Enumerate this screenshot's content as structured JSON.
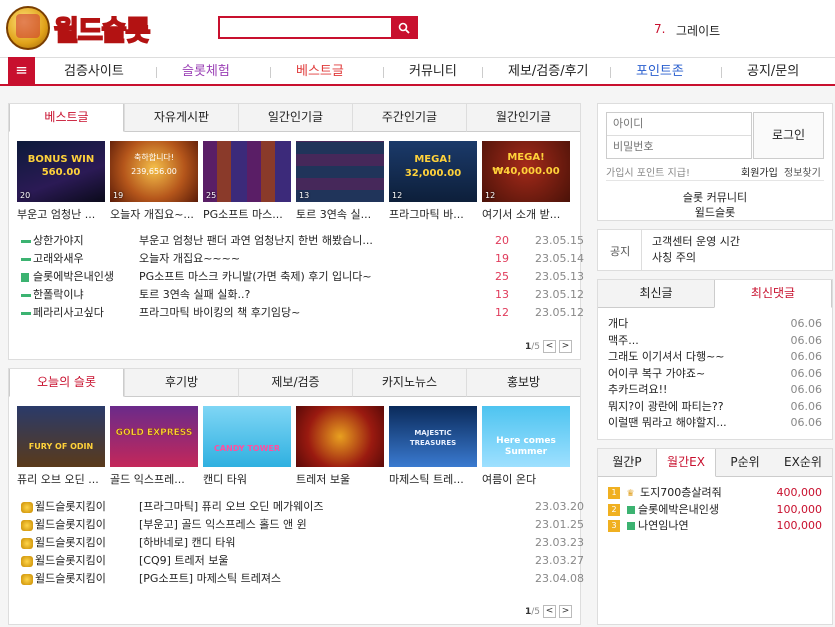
{
  "header": {
    "logo_text": "윌드슬롯",
    "search_placeholder": "",
    "rank_number": "7.",
    "rank_text": "그레이트"
  },
  "nav": {
    "menu_icon": "hamburger-icon",
    "items": [
      "검증사이트",
      "슬롯체험",
      "베스트글",
      "커뮤니티",
      "제보/검증/후기",
      "포인트존",
      "공지/문의"
    ],
    "colors": {
      "슬롯체험": "#9a3fb5",
      "베스트글": "#e03b3b",
      "포인트존": "#2a5fcf"
    }
  },
  "best": {
    "tabs": [
      "베스트글",
      "자유게시판",
      "일간인기글",
      "주간인기글",
      "월간인기글"
    ],
    "thumbs": [
      {
        "count": "20",
        "caption": "부운고 엄청난 ...",
        "img_text": "BONUS WIN 560.00"
      },
      {
        "count": "19",
        "caption": "오늘자 개집요~...",
        "img_text": "축하합니다! 239,656.00"
      },
      {
        "count": "25",
        "caption": "PG소프트 마스...",
        "img_text": ""
      },
      {
        "count": "13",
        "caption": "토르 3연속 실...",
        "img_text": ""
      },
      {
        "count": "12",
        "caption": "프라그마틱 바...",
        "img_text": "MEGA! 32,000.00"
      },
      {
        "count": "12",
        "caption": "여기서 소개 받...",
        "img_text": "MEGA! ₩40,000.00"
      }
    ],
    "rows": [
      {
        "user": "상한가야지",
        "title": "부운고 엄청난 팬더 과연 엄청난지 한번 해봤습니...",
        "num": "20",
        "date": "23.05.15"
      },
      {
        "user": "고래와새우",
        "title": "오늘자 개집요~~~~",
        "num": "19",
        "date": "23.05.14"
      },
      {
        "user": "슬롯에박은내인생",
        "title": "PG소프트 마스크 카니발(가면 축제) 후기 입니다~",
        "num": "25",
        "date": "23.05.13"
      },
      {
        "user": "한폴락이냐",
        "title": "토르 3연속 실패 실화..?",
        "num": "13",
        "date": "23.05.12"
      },
      {
        "user": "페라리사고싶다",
        "title": "프라그마틱 바이킹의 책 후기임당~",
        "num": "12",
        "date": "23.05.12"
      }
    ],
    "pager": {
      "current": "1",
      "total": "/5",
      "prev": "<",
      "next": ">"
    }
  },
  "slots": {
    "tabs": [
      "오늘의 슬롯",
      "후기방",
      "제보/검증",
      "카지노뉴스",
      "홍보방"
    ],
    "thumbs": [
      {
        "caption": "퓨리 오브 오딘 ...",
        "img_text": "FURY OF ODIN"
      },
      {
        "caption": "골드 익스프레...",
        "img_text": "GOLD EXPRESS"
      },
      {
        "caption": "캔디 타워",
        "img_text": "CANDY TOWER"
      },
      {
        "caption": "트레저 보울",
        "img_text": ""
      },
      {
        "caption": "마제스틱 트레...",
        "img_text": "MAJESTIC TREASURES"
      },
      {
        "caption": "여름이 온다",
        "img_text": "Here comes Summer"
      }
    ],
    "rows": [
      {
        "user": "윌드슬롯지킴이",
        "title": "[프라그마틱] 퓨리 오브 오딘 메가웨이즈",
        "date": "23.03.20"
      },
      {
        "user": "윌드슬롯지킴이",
        "title": "[부운고] 골드 익스프레스 홀드 앤 윈",
        "date": "23.01.25"
      },
      {
        "user": "윌드슬롯지킴이",
        "title": "[하바네로] 캔디 타워",
        "date": "23.03.23"
      },
      {
        "user": "윌드슬롯지킴이",
        "title": "[CQ9] 트레저 보울",
        "date": "23.03.27"
      },
      {
        "user": "윌드슬롯지킴이",
        "title": "[PG소프트] 마제스틱 트레져스",
        "date": "23.04.08"
      }
    ],
    "pager": {
      "current": "1",
      "total": "/5",
      "prev": "<",
      "next": ">"
    }
  },
  "login": {
    "id_placeholder": "아이디",
    "pw_placeholder": "비밀번호",
    "login_button": "로그인",
    "signup_text": "가입시 포인트 지급!",
    "signup_link": "회원가입",
    "find_link": "정보찾기",
    "community_line1": "슬롯 커뮤니티",
    "community_line2": "윌드슬롯"
  },
  "notice": {
    "label": "공지",
    "lines": [
      "고객센터 운영 시간",
      "사칭 주의"
    ]
  },
  "latest": {
    "tabs": [
      "최신글",
      "최신댓글"
    ],
    "rows": [
      {
        "text": "개다",
        "date": "06.06"
      },
      {
        "text": "맥주...",
        "date": "06.06"
      },
      {
        "text": "그래도 이기셔서 다행~~",
        "date": "06.06"
      },
      {
        "text": "어이쿠 복구 가야죠~",
        "date": "06.06"
      },
      {
        "text": "추카드려요!!",
        "date": "06.06"
      },
      {
        "text": "뭐지?이 광란에 파티는??",
        "date": "06.06"
      },
      {
        "text": "이럴땐 뭐라고 해야할지...",
        "date": "06.06"
      }
    ]
  },
  "ranking": {
    "tabs": [
      "월간P",
      "월간EX",
      "P순위",
      "EX순위"
    ],
    "rows": [
      {
        "rank": "1",
        "name": "도지700층살려줘",
        "value": "400,000"
      },
      {
        "rank": "2",
        "name": "슬롯에박은내인생",
        "value": "100,000"
      },
      {
        "rank": "3",
        "name": "나연임나연",
        "value": "100,000"
      }
    ]
  },
  "colors": {
    "accent": "#c8102e",
    "count_red": "#e03b5b"
  }
}
